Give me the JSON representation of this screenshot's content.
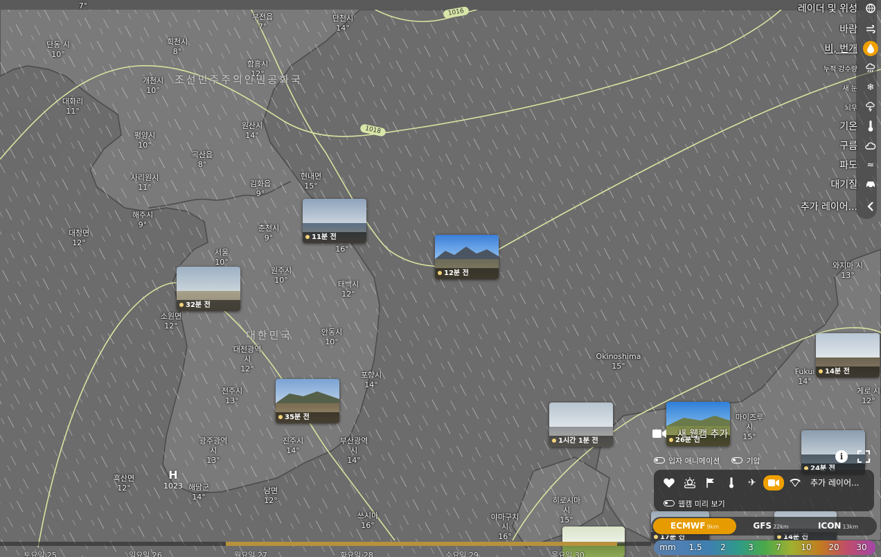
{
  "map": {
    "cities": [
      {
        "name": "",
        "temp": "7°"
      },
      {
        "name": "단동 시",
        "temp": "10°"
      },
      {
        "name": "희천시",
        "temp": "8°"
      },
      {
        "name": "부전읍",
        "temp": "7°"
      },
      {
        "name": "단천시",
        "temp": "14°"
      },
      {
        "name": "함흥시",
        "temp": "12°"
      },
      {
        "name": "개천시",
        "temp": "10°"
      },
      {
        "name": "대화리",
        "temp": "11°"
      },
      {
        "name": "원산시",
        "temp": "14°"
      },
      {
        "name": "평양시",
        "temp": "10°"
      },
      {
        "name": "곡산읍",
        "temp": "8°"
      },
      {
        "name": "현내면",
        "temp": "15°"
      },
      {
        "name": "사리원시",
        "temp": "11°"
      },
      {
        "name": "김화읍",
        "temp": "9°"
      },
      {
        "name": "해주시",
        "temp": "9°"
      },
      {
        "name": "춘천시",
        "temp": "9°"
      },
      {
        "name": "대청면",
        "temp": "12°"
      },
      {
        "name": "서울",
        "temp": "10°"
      },
      {
        "name": "원주시",
        "temp": "10°"
      },
      {
        "name": "",
        "temp": "16°"
      },
      {
        "name": "태백시",
        "temp": "12°"
      },
      {
        "name": "소원면",
        "temp": "12°"
      },
      {
        "name": "안동시",
        "temp": "10°"
      },
      {
        "name": "대전광역시",
        "temp": "12°"
      },
      {
        "name": "포항시",
        "temp": "14°"
      },
      {
        "name": "전주시",
        "temp": "13°"
      },
      {
        "name": "광주광역시",
        "temp": "13°"
      },
      {
        "name": "진주시",
        "temp": "14°"
      },
      {
        "name": "부산광역시",
        "temp": "14°"
      },
      {
        "name": "흑산면",
        "temp": "12°"
      },
      {
        "name": "해남군",
        "temp": "14°"
      },
      {
        "name": "남면",
        "temp": "12°"
      },
      {
        "name": "쓰시마",
        "temp": "16°"
      },
      {
        "name": "Okinoshima",
        "temp": "15°"
      },
      {
        "name": "와지마 시",
        "temp": "13°"
      },
      {
        "name": "Fukui",
        "temp": "14°"
      },
      {
        "name": "게로 시",
        "temp": "12°"
      },
      {
        "name": "마이즈루시",
        "temp": "15°"
      },
      {
        "name": "히로시마시",
        "temp": "15°"
      },
      {
        "name": "야마구치시",
        "temp": "16°"
      }
    ],
    "countries": {
      "north": "조선민주주의인민공화국",
      "south": "대한민국"
    },
    "isobars": [
      "1016",
      "1018"
    ],
    "high": {
      "letter": "H",
      "value": "1023"
    }
  },
  "webcams": [
    {
      "ago": "11분 전"
    },
    {
      "ago": "12분 전"
    },
    {
      "ago": "32분 전"
    },
    {
      "ago": "35분 전"
    },
    {
      "ago": "1시간 1분 전"
    },
    {
      "ago": "26분 전"
    },
    {
      "ago": "14분 전"
    },
    {
      "ago": "24분 전"
    },
    {
      "ago": "17분 전"
    },
    {
      "ago": "14분 전"
    }
  ],
  "layers": [
    {
      "label": "레이더 및 위성",
      "icon": "globe-icon"
    },
    {
      "label": "바람",
      "icon": "wind-icon"
    },
    {
      "label": "비, 번개",
      "icon": "raindrop-icon",
      "active": true
    },
    {
      "label": "누적 강수량",
      "icon": "rain-cloud-icon"
    },
    {
      "label": "새 눈",
      "icon": "snowflake-icon"
    },
    {
      "label": "뇌우",
      "icon": "thunder-icon"
    },
    {
      "label": "기온",
      "icon": "thermometer-icon"
    },
    {
      "label": "구름",
      "icon": "cloud-icon"
    },
    {
      "label": "파도",
      "icon": "waves-icon"
    },
    {
      "label": "대기질",
      "icon": "car-icon"
    },
    {
      "label": "추가 레이어...",
      "icon": "chevron-left-icon"
    }
  ],
  "webcam_panel": {
    "add_label": "새 웹캠 추가",
    "toggle_animation": "입자 애니메이션",
    "toggle_pressure": "기압",
    "more_layers": "추가 레이어...",
    "preview": "웹캠 미리 보기"
  },
  "models": [
    {
      "name": "ECMWF",
      "res": "9km",
      "active": true
    },
    {
      "name": "GFS",
      "res": "22km"
    },
    {
      "name": "ICON",
      "res": "13km"
    }
  ],
  "legend": {
    "unit": "mm",
    "ticks": [
      "1.5",
      "2",
      "3",
      "7",
      "10",
      "20",
      "30"
    ]
  },
  "timeline": {
    "days": [
      "토요일 25",
      "일요일 26",
      "월요일 27",
      "화요일 28",
      "수요일 29",
      "목요일 30"
    ]
  },
  "colors": {
    "accent": "#f0a000",
    "land": "#7a7a7a",
    "sea": "#6c6c6c",
    "isobar": "#d9e4a0"
  }
}
